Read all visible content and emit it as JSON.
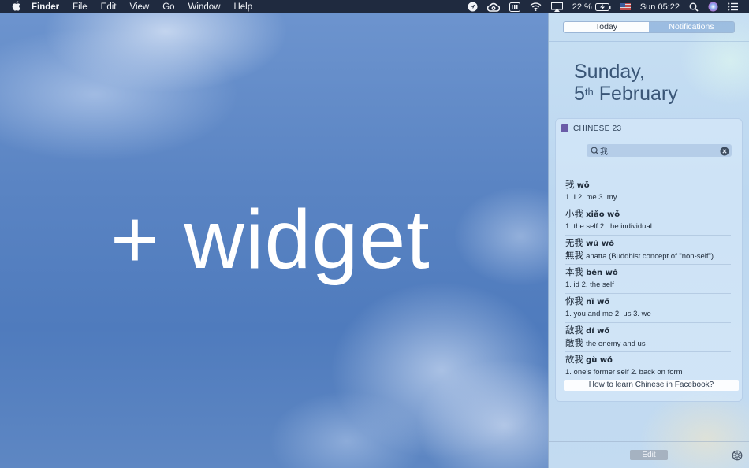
{
  "menubar": {
    "app_name": "Finder",
    "menus": [
      "File",
      "Edit",
      "View",
      "Go",
      "Window",
      "Help"
    ],
    "battery": "22 %",
    "clock": "Sun 05:22"
  },
  "desktop": {
    "overlay_text": "+ widget"
  },
  "notification_center": {
    "tabs": [
      {
        "label": "Today",
        "active": true
      },
      {
        "label": "Notifications",
        "active": false
      }
    ],
    "date": {
      "weekday": "Sunday,",
      "day": "5",
      "ordinal": "th",
      "month": "February"
    },
    "widget": {
      "title": "CHINESE 23",
      "search_value": "我",
      "results": [
        {
          "line1_hanzi": "我",
          "line1_pinyin": "wǒ",
          "line2_hanzi": "",
          "definition": "1. I 2. me 3. my"
        },
        {
          "line1_hanzi": "小我",
          "line1_pinyin": "xiǎo wǒ",
          "line2_hanzi": "",
          "definition": "1. the self 2. the individual"
        },
        {
          "line1_hanzi": "无我",
          "line1_pinyin": "wú wǒ",
          "line2_hanzi": "無我",
          "definition": "anatta (Buddhist concept of \"non-self\")"
        },
        {
          "line1_hanzi": "本我",
          "line1_pinyin": "běn wǒ",
          "line2_hanzi": "",
          "definition": "1. id 2. the self"
        },
        {
          "line1_hanzi": "你我",
          "line1_pinyin": "nǐ wǒ",
          "line2_hanzi": "",
          "definition": "1. you and me 2. us 3. we"
        },
        {
          "line1_hanzi": "敌我",
          "line1_pinyin": "dí wǒ",
          "line2_hanzi": "敵我",
          "definition": "the enemy and us"
        },
        {
          "line1_hanzi": "故我",
          "line1_pinyin": "gù wǒ",
          "line2_hanzi": "",
          "definition": "1. one's former self 2. back on form"
        }
      ],
      "ad_label": "How to learn Chinese in Facebook?"
    },
    "edit_label": "Edit"
  }
}
